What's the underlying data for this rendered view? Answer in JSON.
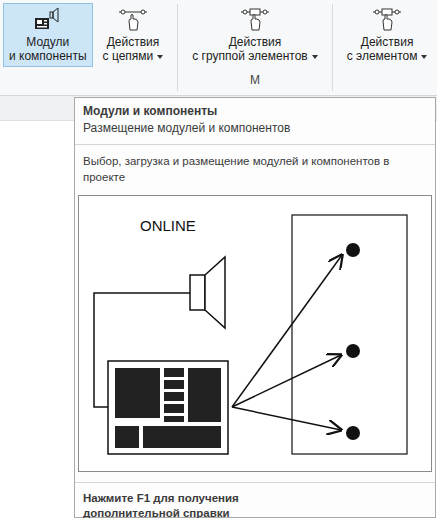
{
  "ribbon": {
    "groups": [
      {
        "label": "",
        "buttons": [
          {
            "lines": [
              "Модули",
              "и компоненты"
            ],
            "selected": true,
            "dropdown": false,
            "kind": "modules"
          },
          {
            "lines": [
              "Действия",
              "с цепями"
            ],
            "selected": false,
            "dropdown": true,
            "kind": "chain"
          }
        ]
      },
      {
        "label": "М",
        "buttons": [
          {
            "lines": [
              "Действия",
              "с группой элементов"
            ],
            "selected": false,
            "dropdown": true,
            "kind": "group"
          }
        ]
      },
      {
        "label": "",
        "buttons": [
          {
            "lines": [
              "Действия",
              "с элементом"
            ],
            "selected": false,
            "dropdown": true,
            "kind": "element"
          }
        ]
      }
    ]
  },
  "tooltip": {
    "title": "Модули и компоненты",
    "subtitle": "Размещение модулей и компонентов",
    "description": [
      "Выбор, загрузка и размещение модулей и компонентов в",
      "проекте"
    ],
    "image": {
      "caption": "ONLINE"
    },
    "footer": [
      "Нажмите F1 для получения",
      "дополнительной справки"
    ]
  }
}
